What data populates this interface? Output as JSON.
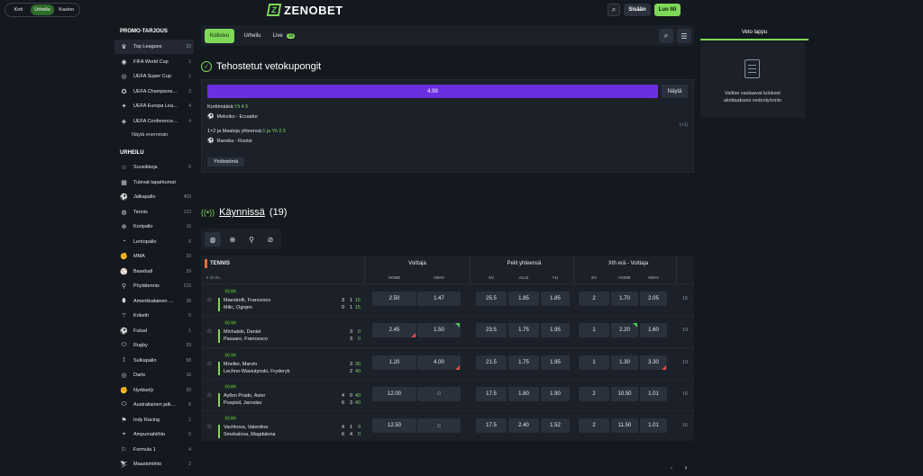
{
  "header": {
    "modes": [
      "Koti",
      "Urheilu",
      "Kasino"
    ],
    "brand": "ZENOBET",
    "login_label": "Sisään",
    "signup_label": "Luo tili"
  },
  "sidebar": {
    "promo_title": "PROMO-TARJOUS",
    "promo_items": [
      {
        "label": "Top Leagues",
        "count": "33",
        "icon": "trophy-icon"
      },
      {
        "label": "FIFA World Cup",
        "count": "1",
        "icon": "world-cup-icon"
      },
      {
        "label": "UEFA Super Cup",
        "count": "1",
        "icon": "super-cup-icon"
      },
      {
        "label": "UEFA Champions…",
        "count": "2",
        "icon": "champions-league-icon"
      },
      {
        "label": "UEFA Europa Lea…",
        "count": "4",
        "icon": "europa-league-icon"
      },
      {
        "label": "UEFA Conference…",
        "count": "4",
        "icon": "conference-league-icon"
      }
    ],
    "show_more": "Näytä enemmän",
    "sports_title": "URHEILU",
    "sports": [
      {
        "label": "Suosikkeja",
        "count": "0",
        "icon": "star-icon"
      },
      {
        "label": "Tulevat tapahtumat",
        "count": "",
        "icon": "calendar-icon"
      },
      {
        "label": "Jalkapallo",
        "count": "469",
        "icon": "football-icon"
      },
      {
        "label": "Tennis",
        "count": "123",
        "icon": "tennis-icon"
      },
      {
        "label": "Koripallo",
        "count": "16",
        "icon": "basketball-icon"
      },
      {
        "label": "Lentopallo",
        "count": "5",
        "icon": "volleyball-icon"
      },
      {
        "label": "MMA",
        "count": "29",
        "icon": "mma-icon"
      },
      {
        "label": "Baseball",
        "count": "29",
        "icon": "baseball-icon"
      },
      {
        "label": "Pöytätennis",
        "count": "216",
        "icon": "table-tennis-icon"
      },
      {
        "label": "Amerikkalainen …",
        "count": "38",
        "icon": "american-football-icon"
      },
      {
        "label": "Kriketti",
        "count": "5",
        "icon": "cricket-icon"
      },
      {
        "label": "Futsal",
        "count": "1",
        "icon": "futsal-icon"
      },
      {
        "label": "Rugby",
        "count": "29",
        "icon": "rugby-icon"
      },
      {
        "label": "Sulkapallo",
        "count": "58",
        "icon": "badminton-icon"
      },
      {
        "label": "Darts",
        "count": "16",
        "icon": "darts-icon"
      },
      {
        "label": "Nyrkkeily",
        "count": "30",
        "icon": "boxing-icon"
      },
      {
        "label": "Australiainen jalk…",
        "count": "8",
        "icon": "aussie-rules-icon"
      },
      {
        "label": "Indy Racing",
        "count": "1",
        "icon": "racing-icon"
      },
      {
        "label": "Ampumahiihto",
        "count": "6",
        "icon": "biathlon-icon"
      },
      {
        "label": "Formula 1",
        "count": "4",
        "icon": "formula1-icon"
      },
      {
        "label": "Maastohiihto",
        "count": "2",
        "icon": "skiing-icon"
      }
    ]
  },
  "tabs": [
    {
      "label": "Kotisivu",
      "active": true
    },
    {
      "label": "Urheilu",
      "active": false
    },
    {
      "label": "Live",
      "badge": "19",
      "active": false
    }
  ],
  "boosted": {
    "title": "Tehostetut vetokupongit",
    "odds": "4.99",
    "show_label": "Näytä",
    "line1_label": "Korttimäärä:",
    "line1_value": "Yli 4.5",
    "line1_match": "Meksiko - Ecuador",
    "line2_label": "1×2 ja Maaleja yhteensä:",
    "line2_value": "1 ja Yli 2.5",
    "line2_match": "Ranska - Ruotsi",
    "more": "(+1)",
    "combo_label": "Yhdistelmä"
  },
  "live": {
    "title": "Käynnissä",
    "count": "(19)",
    "sport": "TENNIS",
    "date": "ti 30.06.",
    "markets": [
      "Voittaja",
      "Pelit yhteensä",
      "Xth erä - Voittaja"
    ],
    "sub_headers": [
      "HOME",
      "AWAY",
      "SV",
      "ALLE",
      "YLI",
      "SV",
      "HOME",
      "AWAY"
    ],
    "matches": [
      {
        "set": "2S",
        "p1": "Maestrelli, Francesco",
        "p2": "Milic, Ognjen",
        "s1": [
          "3",
          "1",
          "15"
        ],
        "s2": [
          "0",
          "1",
          "15"
        ],
        "odds": [
          "2.50",
          "1.47",
          "25.5",
          "1.85",
          "1.85",
          "2",
          "1.70",
          "2.05"
        ],
        "more": "16"
      },
      {
        "set": "1S",
        "p1": "Michalski, Daniel",
        "p2": "Passaro, Francesco",
        "s1": [
          "",
          "3",
          "0"
        ],
        "s2": [
          "",
          "3",
          "0"
        ],
        "odds": [
          "2.45",
          "1.50",
          "23.5",
          "1.75",
          "1.95",
          "1",
          "2.20",
          "1.60"
        ],
        "more": "19"
      },
      {
        "set": "1S",
        "p1": "Moeller, Marvin",
        "p2": "Lechno-Wasiutynski, Fryderyk",
        "s1": [
          "",
          "3",
          "30"
        ],
        "s2": [
          "",
          "2",
          "40"
        ],
        "odds": [
          "1.20",
          "4.00",
          "21.5",
          "1.75",
          "1.95",
          "1",
          "1.30",
          "3.30"
        ],
        "more": "19"
      },
      {
        "set": "2S",
        "p1": "Ayllon Prado, Asier",
        "p2": "Pospisil, Jaroslav",
        "s1": [
          "4",
          "0",
          "40"
        ],
        "s2": [
          "6",
          "3",
          "40"
        ],
        "odds": [
          "12.00",
          "",
          "17.5",
          "1.80",
          "1.90",
          "2",
          "10.50",
          "1.01"
        ],
        "more": "16"
      },
      {
        "set": "2S",
        "p1": "Vachkova, Valentina",
        "p2": "Smekalova, Magdalena",
        "s1": [
          "4",
          "1",
          "0"
        ],
        "s2": [
          "6",
          "4",
          "0"
        ],
        "odds": [
          "12.50",
          "",
          "17.5",
          "2.40",
          "1.52",
          "2",
          "11.50",
          "1.01"
        ],
        "more": "16"
      }
    ]
  },
  "betslip": {
    "title": "Veto lappu",
    "empty_text": "Valitse vastaavat tulokset aloittaaksesi vedonlyönnin"
  },
  "colors": {
    "accent": "#7dd957",
    "odds_bar": "#6a2fe0",
    "bg": "#14181f",
    "panel": "#1b2029"
  }
}
